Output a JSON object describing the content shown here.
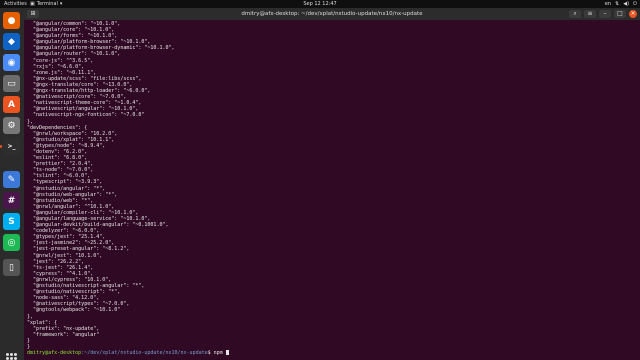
{
  "topbar": {
    "activities": "Activities",
    "app_name": "Terminal",
    "clock": "Sep 12  12:47",
    "language": "en"
  },
  "dock": {
    "items": [
      {
        "name": "firefox-icon",
        "glyph": "●",
        "color": "#e66000",
        "active": false
      },
      {
        "name": "vscode-icon",
        "glyph": "◆",
        "color": "#0e63c4",
        "active": false
      },
      {
        "name": "chromium-icon",
        "glyph": "◉",
        "color": "#4b8bf5",
        "active": false
      },
      {
        "name": "files-icon",
        "glyph": "▭",
        "color": "#6c6c6c",
        "active": false
      },
      {
        "name": "software-icon",
        "glyph": "A",
        "color": "#e95420",
        "active": false
      },
      {
        "name": "settings-icon",
        "glyph": "⚙",
        "color": "#777777",
        "active": false
      },
      {
        "name": "terminal-icon",
        "glyph": ">_",
        "color": "#2e2e2e",
        "active": true
      },
      {
        "name": "text-editor-icon",
        "glyph": "✎",
        "color": "#3c78d8",
        "active": false
      },
      {
        "name": "slack-icon",
        "glyph": "#",
        "color": "#4a154b",
        "active": false
      },
      {
        "name": "skype-icon",
        "glyph": "S",
        "color": "#00aff0",
        "active": false
      },
      {
        "name": "spotify-icon",
        "glyph": "◎",
        "color": "#1db954",
        "active": false
      },
      {
        "name": "trash-icon",
        "glyph": "▯",
        "color": "#555555",
        "active": false
      }
    ]
  },
  "window": {
    "title": "dmitry@afx-desktop: ~/dev/xplat/nstudio-update/nx10/nx-update"
  },
  "terminal": {
    "lines": [
      "  \"@angular/common\": \"~10.1.0\",",
      "  \"@angular/core\": \"~10.1.0\",",
      "  \"@angular/forms\": \"~10.1.0\",",
      "  \"@angular/platform-browser\": \"~10.1.0\",",
      "  \"@angular/platform-browser-dynamic\": \"~10.1.0\",",
      "  \"@angular/router\": \"~10.1.0\",",
      "  \"core-js\": \"^3.6.5\",",
      "  \"rxjs\": \"~6.6.0\",",
      "  \"zone.js\": \"~0.11.1\",",
      "  \"@nx-update/scss\": \"file:libs/scss\",",
      "  \"@ngx-translate/core\": \"~13.0.0\",",
      "  \"@ngx-translate/http-loader\": \"~6.0.0\",",
      "  \"@nativescript/core\": \"~7.0.0\",",
      "  \"nativescript-theme-core\": \"~1.0.4\",",
      "  \"@nativescript/angular\": \"~10.1.0\",",
      "  \"nativescript-ngx-fonticon\": \"~7.0.0\"",
      "},",
      "\"devDependencies\": {",
      "  \"@nrwl/workspace\": \"10.2.0\",",
      "  \"@nstudio/xplat\": \"10.1.1\",",
      "  \"@types/node\": \"~8.9.4\",",
      "  \"dotenv\": \"6.2.0\",",
      "  \"eslint\": \"6.8.0\",",
      "  \"prettier\": \"2.0.4\",",
      "  \"ts-node\": \"~7.0.0\",",
      "  \"tslint\": \"~6.0.0\",",
      "  \"typescript\": \"~3.9.3\",",
      "  \"@nstudio/angular\": \"*\",",
      "  \"@nstudio/web-angular\": \"*\",",
      "  \"@nstudio/web\": \"*\",",
      "  \"@nrwl/angular\": \"^10.1.0\",",
      "  \"@angular/compiler-cli\": \"~10.1.0\",",
      "  \"@angular/language-service\": \"~10.1.0\",",
      "  \"@angular-devkit/build-angular\": \"~0.1001.0\",",
      "  \"codelyzer\": \"~6.0.0\",",
      "  \"@types/jest\": \"25.1.4\",",
      "  \"jest-jasmine2\": \"~25.2.0\",",
      "  \"jest-preset-angular\": \"~8.1.2\",",
      "  \"@nrwl/jest\": \"10.1.0\",",
      "  \"jest\": \"26.2.2\",",
      "  \"ts-jest\": \"26.1.4\",",
      "  \"cypress\": \"^4.1.0\",",
      "  \"@nrwl/cypress\": \"10.1.0\",",
      "  \"@nstudio/nativescript-angular\": \"*\",",
      "  \"@nstudio/nativescript\": \"*\",",
      "  \"node-sass\": \"4.12.0\",",
      "  \"@nativescript/types\": \"~7.0.0\",",
      "  \"@ngtools/webpack\": \"~10.1.0\"",
      "},",
      "\"xplat\": {",
      "  \"prefix\": \"nx-update\",",
      "  \"framework\": \"angular\"",
      "}",
      "}"
    ],
    "prompt_user": "dmitry@afx-desktop",
    "prompt_path": ":~/dev/xplat/nstudio-update/nx10/nx-update",
    "prompt_symbol": "$ ",
    "command": "npm "
  }
}
